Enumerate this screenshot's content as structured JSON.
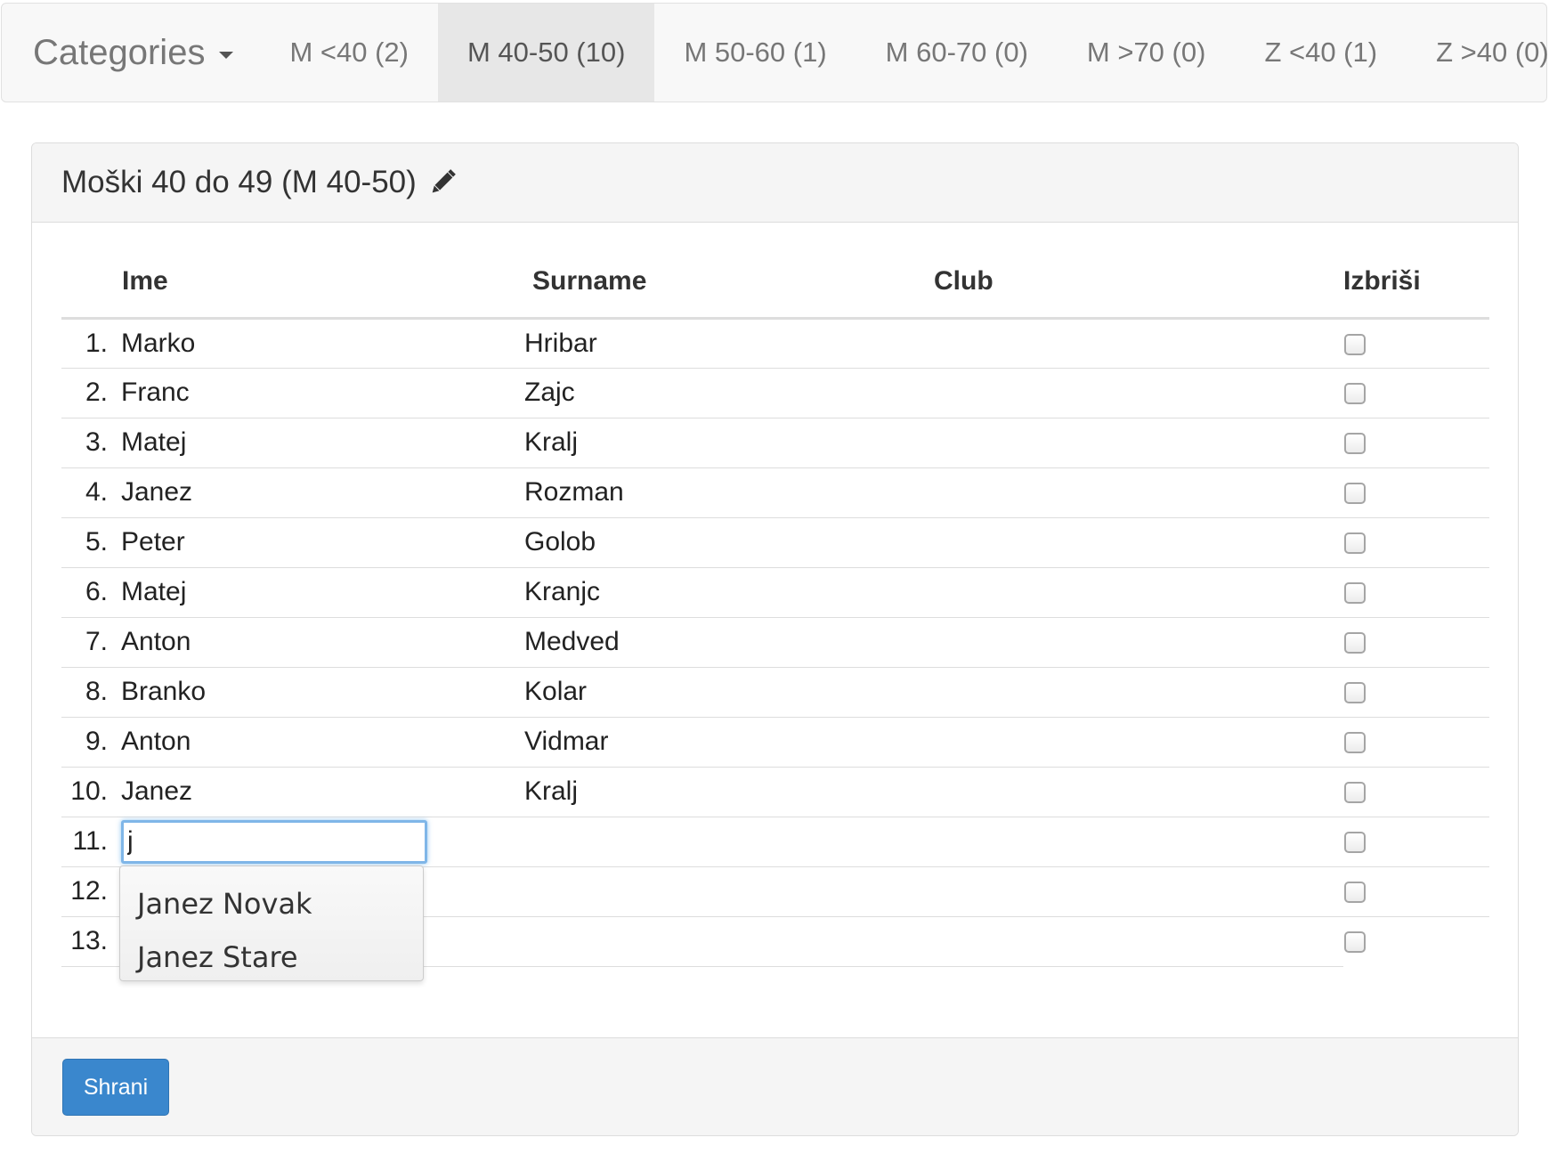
{
  "navbar": {
    "brand": "Categories",
    "tabs": [
      {
        "label": "M <40 (2)",
        "active": false
      },
      {
        "label": "M 40-50 (10)",
        "active": true
      },
      {
        "label": "M 50-60 (1)",
        "active": false
      },
      {
        "label": "M 60-70 (0)",
        "active": false
      },
      {
        "label": "M >70 (0)",
        "active": false
      },
      {
        "label": "Z <40 (1)",
        "active": false
      },
      {
        "label": "Z >40 (0)",
        "active": false
      }
    ]
  },
  "panel": {
    "title": "Moški 40 do 49 (M 40-50)",
    "edit_icon": "pencil-icon"
  },
  "table": {
    "headers": {
      "ime": "Ime",
      "surname": "Surname",
      "club": "Club",
      "delete": "Izbriši"
    },
    "rows": [
      {
        "num": "1.",
        "ime": "Marko",
        "surname": "Hribar",
        "club": ""
      },
      {
        "num": "2.",
        "ime": "Franc",
        "surname": "Zajc",
        "club": ""
      },
      {
        "num": "3.",
        "ime": "Matej",
        "surname": "Kralj",
        "club": ""
      },
      {
        "num": "4.",
        "ime": "Janez",
        "surname": "Rozman",
        "club": ""
      },
      {
        "num": "5.",
        "ime": "Peter",
        "surname": "Golob",
        "club": ""
      },
      {
        "num": "6.",
        "ime": "Matej",
        "surname": "Kranjc",
        "club": ""
      },
      {
        "num": "7.",
        "ime": "Anton",
        "surname": "Medved",
        "club": ""
      },
      {
        "num": "8.",
        "ime": "Branko",
        "surname": "Kolar",
        "club": ""
      },
      {
        "num": "9.",
        "ime": "Anton",
        "surname": "Vidmar",
        "club": ""
      },
      {
        "num": "10.",
        "ime": "Janez",
        "surname": "Kralj",
        "club": ""
      }
    ],
    "input_rows": [
      {
        "num": "11.",
        "value": "j"
      },
      {
        "num": "12.",
        "value": ""
      },
      {
        "num": "13.",
        "value": ""
      }
    ]
  },
  "autocomplete": {
    "items": [
      "Janez Novak",
      "Janez Stare"
    ]
  },
  "footer": {
    "save_label": "Shrani"
  },
  "colors": {
    "primary_button": "#3a87cd",
    "active_tab": "#e7e7e7",
    "input_focus": "#7fb6e8"
  }
}
